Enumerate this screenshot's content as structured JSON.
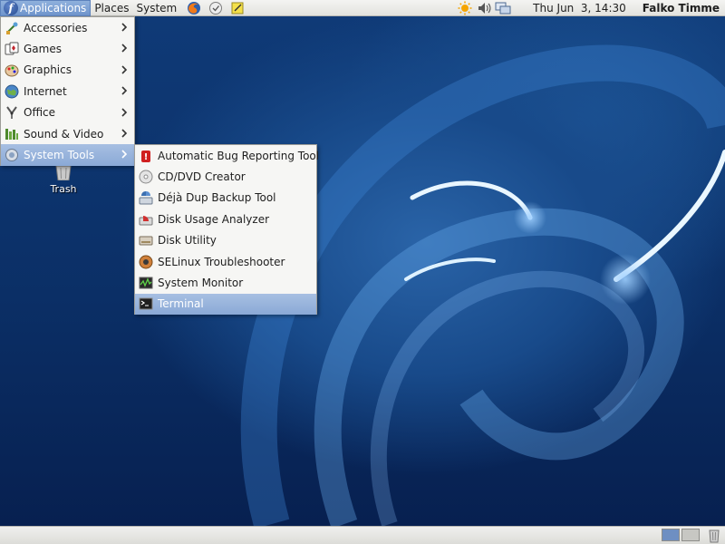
{
  "top_panel": {
    "menus": {
      "applications": "Applications",
      "places": "Places",
      "system": "System"
    },
    "logo_glyph": "f",
    "launchers": [
      "firefox-icon",
      "mail-icon",
      "notes-icon"
    ],
    "tray": [
      "weather-sun-icon",
      "volume-icon",
      "network-icon"
    ],
    "clock": "Thu Jun  3, 14:30",
    "user": "Falko Timme"
  },
  "app_menu": {
    "items": [
      {
        "label": "Accessories",
        "icon": "accessories-icon"
      },
      {
        "label": "Games",
        "icon": "games-icon"
      },
      {
        "label": "Graphics",
        "icon": "graphics-icon"
      },
      {
        "label": "Internet",
        "icon": "internet-icon"
      },
      {
        "label": "Office",
        "icon": "office-icon"
      },
      {
        "label": "Sound & Video",
        "icon": "sound-video-icon"
      },
      {
        "label": "System Tools",
        "icon": "system-tools-icon",
        "selected": true
      }
    ]
  },
  "system_tools_menu": {
    "items": [
      {
        "label": "Automatic Bug Reporting Tool",
        "icon": "bug-report-icon"
      },
      {
        "label": "CD/DVD Creator",
        "icon": "cd-dvd-icon"
      },
      {
        "label": "Déjà Dup Backup Tool",
        "icon": "backup-icon"
      },
      {
        "label": "Disk Usage Analyzer",
        "icon": "disk-usage-icon"
      },
      {
        "label": "Disk Utility",
        "icon": "disk-utility-icon"
      },
      {
        "label": "SELinux Troubleshooter",
        "icon": "selinux-icon"
      },
      {
        "label": "System Monitor",
        "icon": "system-monitor-icon"
      },
      {
        "label": "Terminal",
        "icon": "terminal-icon",
        "selected": true
      }
    ]
  },
  "desktop": {
    "trash_label": "Trash"
  },
  "bottom_panel": {
    "workspaces": 2,
    "active_workspace": 1
  },
  "colors": {
    "highlight": "#8aa9d6",
    "desktop_blue": "#0f3a77",
    "panel": "#e6e6e2"
  }
}
